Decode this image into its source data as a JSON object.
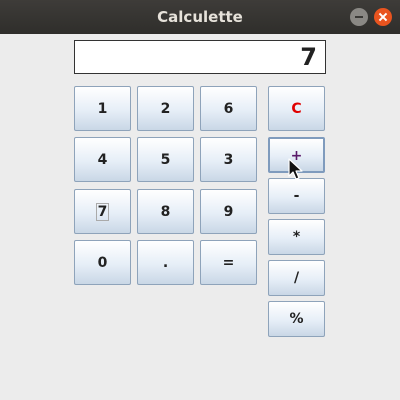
{
  "window": {
    "title": "Calculette",
    "minimize_icon": "minimize-icon",
    "close_icon": "close-icon",
    "close_color": "#e9541f"
  },
  "display": {
    "value": "7"
  },
  "keypad": {
    "rows": [
      [
        "1",
        "2",
        "6"
      ],
      [
        "4",
        "5",
        "3"
      ],
      [
        "7",
        "8",
        "9"
      ],
      [
        "0",
        ".",
        "="
      ]
    ]
  },
  "operators": {
    "clear": "C",
    "plus": "+",
    "minus": "-",
    "multiply": "*",
    "divide": "/",
    "percent": "%"
  },
  "colors": {
    "clear_label": "#e00000",
    "plus_label": "#5a1a6a",
    "button_border": "#8ea3ba"
  },
  "pointer": {
    "icon": "mouse-pointer-icon"
  }
}
